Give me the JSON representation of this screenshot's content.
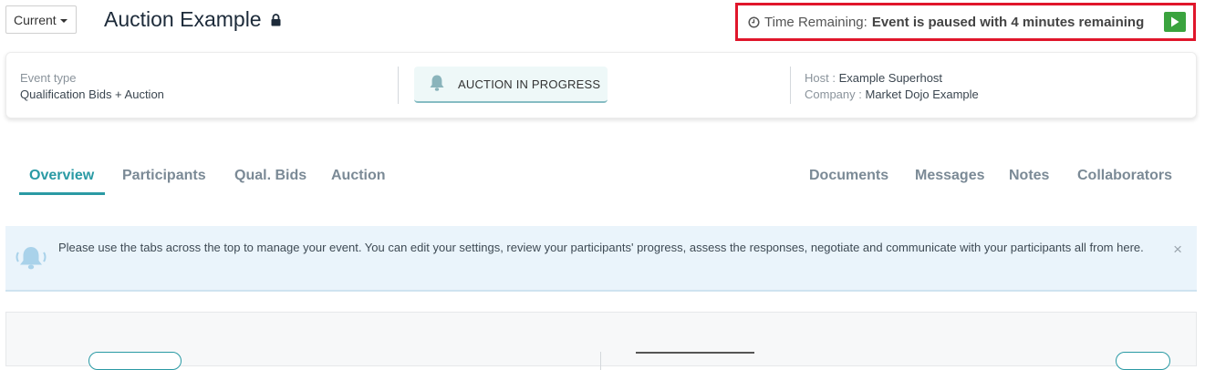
{
  "header": {
    "version_label": "Current",
    "title": "Auction Example"
  },
  "timer": {
    "label": "Time Remaining:",
    "value": "Event is paused with 4 minutes remaining"
  },
  "info": {
    "event_type_key": "Event type",
    "event_type_value": "Qualification Bids + Auction",
    "status": "AUCTION IN PROGRESS",
    "host_key": "Host :",
    "host_value": "Example Superhost",
    "company_key": "Company :",
    "company_value": "Market Dojo Example"
  },
  "tabs_left": [
    "Overview",
    "Participants",
    "Qual. Bids",
    "Auction"
  ],
  "tabs_right": [
    "Documents",
    "Messages",
    "Notes",
    "Collaborators"
  ],
  "banner": {
    "message": "Please use the tabs across the top to manage your event. You can edit your settings, review your participants' progress, assess the responses, negotiate and communicate with your participants all from here.",
    "close_glyph": "×"
  },
  "colors": {
    "accent": "#2a9aa4",
    "highlight_border": "#e0162b",
    "play_green": "#3aa33e"
  }
}
